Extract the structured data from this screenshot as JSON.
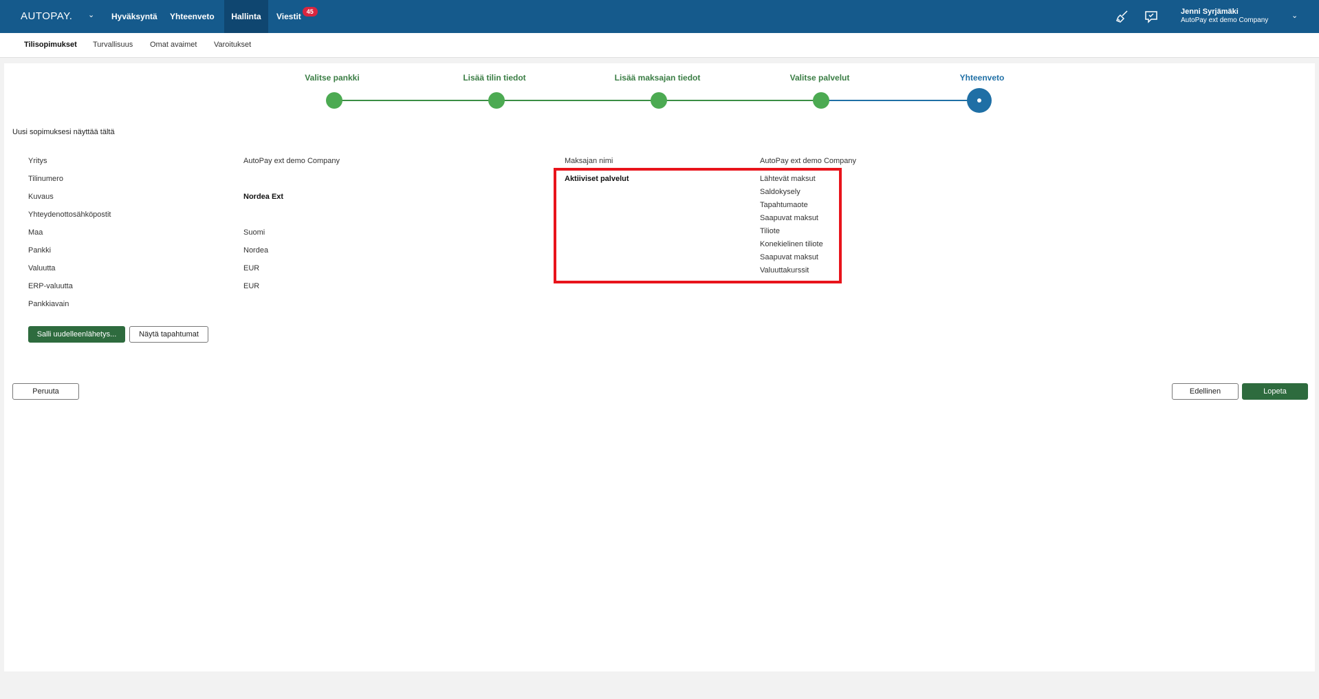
{
  "topbar": {
    "logo": "AUTOPAY.",
    "nav": [
      {
        "label": "Hyväksyntä"
      },
      {
        "label": "Yhteenveto"
      },
      {
        "label": "Hallinta"
      },
      {
        "label": "Viestit"
      }
    ],
    "messages_badge": "45",
    "user_name": "Jenni Syrjämäki",
    "user_company": "AutoPay ext demo Company"
  },
  "subnav": {
    "items": [
      "Tilisopimukset",
      "Turvallisuus",
      "Omat avaimet",
      "Varoitukset"
    ]
  },
  "wizard": {
    "steps": [
      "Valitse pankki",
      "Lisää tilin tiedot",
      "Lisää maksajan tiedot",
      "Valitse palvelut",
      "Yhteenveto"
    ],
    "current_step": 5
  },
  "summary": {
    "intro": "Uusi sopimuksesi näyttää tältä",
    "fields": [
      {
        "label": "Yritys",
        "value": "AutoPay ext demo Company"
      },
      {
        "label": "Tilinumero",
        "value": ""
      },
      {
        "label": "Kuvaus",
        "value": "Nordea Ext"
      },
      {
        "label": "Yhteydenottosähköpostit",
        "value": ""
      },
      {
        "label": "Maa",
        "value": "Suomi"
      },
      {
        "label": "Pankki",
        "value": "Nordea"
      },
      {
        "label": "Valuutta",
        "value": "EUR"
      },
      {
        "label": "ERP-valuutta",
        "value": "EUR"
      },
      {
        "label": "Pankkiavain",
        "value": ""
      }
    ],
    "payer_name_label": "Maksajan nimi",
    "payer_name_value": "AutoPay ext demo Company",
    "active_services_label": "Aktiiviset palvelut",
    "active_services": [
      "Lähtevät maksut",
      "Saldokysely",
      "Tapahtumaote",
      "Saapuvat maksut",
      "Tiliote",
      "Konekielinen tiliote",
      "Saapuvat maksut",
      "Valuuttakurssit"
    ]
  },
  "buttons": {
    "allow_resend": "Salli uudelleenlähetys...",
    "show_events": "Näytä tapahtumat",
    "cancel": "Peruuta",
    "previous": "Edellinen",
    "finish": "Lopeta"
  },
  "colors": {
    "topbar": "#155a8c",
    "step_done": "#4caa52",
    "step_current": "#1f6fa5",
    "primary_button": "#2e6b3e",
    "highlight": "#e8141b",
    "badge": "#d9263f"
  },
  "icons": [
    "chevron-down-icon",
    "broom-icon",
    "feedback-icon"
  ]
}
